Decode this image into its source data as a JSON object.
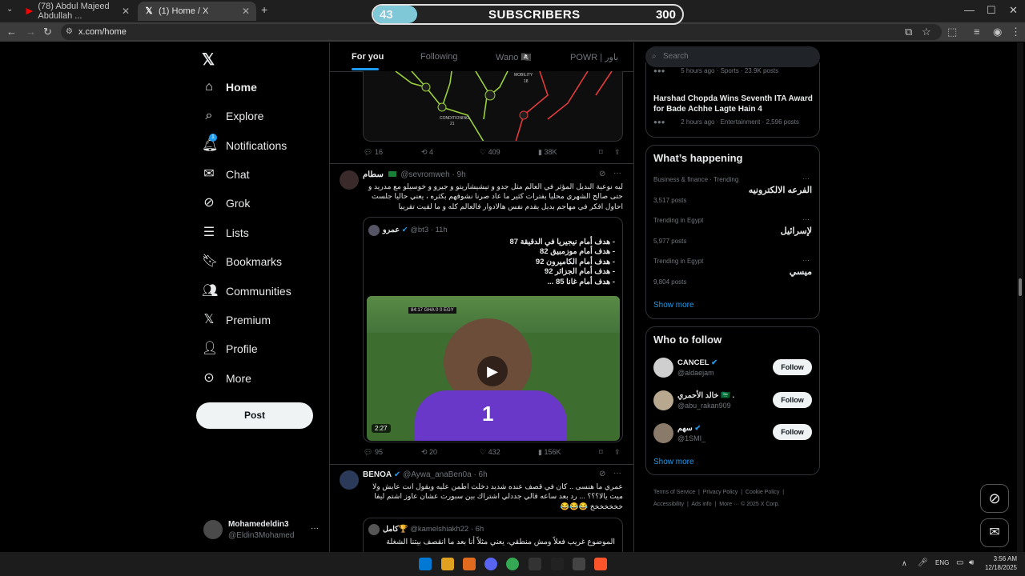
{
  "browser": {
    "tabs": [
      {
        "title": "(78) Abdul Majeed Abdullah ...",
        "icon": "youtube-icon"
      },
      {
        "title": "(1) Home / X",
        "icon": "x-logo-icon"
      }
    ],
    "url": "x.com/home"
  },
  "overlay": {
    "current": "43",
    "label": "SUBSCRIBERS",
    "goal": "300",
    "progress": 0.143
  },
  "nav": {
    "items": [
      "Home",
      "Explore",
      "Notifications",
      "Chat",
      "Grok",
      "Lists",
      "Bookmarks",
      "Communities",
      "Premium",
      "Profile",
      "More"
    ],
    "notification_badge": "1",
    "post_label": "Post"
  },
  "account": {
    "name": "Mohamedeldin3",
    "handle": "@Eldin3Mohamed"
  },
  "feed": {
    "tabs": [
      "For you",
      "Following",
      "Wano 🏴‍☠️",
      "POWR | باور"
    ],
    "first_tweet_actions": {
      "replies": "16",
      "reposts": "4",
      "likes": "409",
      "views": "38K"
    },
    "diagram_labels": {
      "mobility": "MOBILITY",
      "conditioning": "CONDITIONING",
      "num1": "18",
      "num2": "21"
    },
    "tweet2": {
      "name": "سطام",
      "handle": "@sevromweh",
      "time": "· 9h",
      "text": "ليه نوعية البديل المؤثر في العالم مثل جدو و تيشيشاريتو و جيرو و خوسيلو مع مدريد و حتى صالح الشهري محليا بفترات كثير ما عاد صرنا نشوفهم بكثره ، يعني حاليا جلست احاول افكر في مهاجم بديل يقدم نفس هالادوار فالعالم كله و ما لقيت تقريبا",
      "quote": {
        "name": "عمرو",
        "handle": "@bt3",
        "time": "· 11h",
        "lines": [
          "- هدف أمام نيجيريا في الدقيقة 87",
          "- هدف أمام موزمبيق 82",
          "- هدف أمام الكاميرون 92",
          "- هدف أمام الجزائر 92",
          "- هدف أمام غانا 85 ..."
        ],
        "video_duration": "2:27",
        "scoreboard": "84:17 GHA 0 0 EGY",
        "jersey": "1"
      },
      "actions": {
        "replies": "95",
        "reposts": "20",
        "likes": "432",
        "views": "156K"
      }
    },
    "tweet3": {
      "name": "BENOA",
      "handle": "@Aywa_anaBen0a",
      "time": "· 6h",
      "text": "عمري ما هنسى .. كان في قصف عنده شديد دخلت اطمن عليه ويقول انت عايش ولا ميت يالا؟؟؟ ... رد بعد ساعه قالي جددلي اشتراك بين سبورت عشان عاوز اشتم ليفا خخخخخخخ 😂😂😂",
      "quote": {
        "name": "كامل🏆",
        "handle": "@kamelshiakh22",
        "time": "· 6h",
        "text": "الموضوع غريب فعلاً ومش منطقي، يعني مثلاً أنا بعد ما انقصف بيتنا الشغلة"
      }
    }
  },
  "sidebar": {
    "search_placeholder": "Search",
    "top_trend": {
      "meta_partial": "5 hours ago · Sports · 23.9K posts",
      "title": "Harshad Chopda Wins Seventh ITA Award for Bade Achhe Lagte Hain 4",
      "meta": "2 hours ago · Entertainment · 2,596 posts"
    },
    "happening_title": "What’s happening",
    "trends": [
      {
        "context": "Business & finance · Trending",
        "name": "الفرعه الالكترونيه",
        "posts": "3,517 posts"
      },
      {
        "context": "Trending in Egypt",
        "name": "لإسرائيل",
        "posts": "5,977 posts"
      },
      {
        "context": "Trending in Egypt",
        "name": "ميسي",
        "posts": "9,804 posts"
      }
    ],
    "show_more": "Show more",
    "who_to_follow_title": "Who to follow",
    "follow": [
      {
        "name": "CANCEL",
        "handle": "@aldaejam"
      },
      {
        "name": "خالد الأحمري 🇸🇦 .",
        "handle": "@abu_rakan909"
      },
      {
        "name": "سهم",
        "handle": "@1SMI_"
      }
    ],
    "follow_label": "Follow",
    "footer": [
      "Terms of Service",
      "Privacy Policy",
      "Cookie Policy",
      "Accessibility",
      "Ads info",
      "More ···",
      "© 2025 X Corp."
    ]
  },
  "taskbar": {
    "lang": "ENG",
    "time": "3:56 AM",
    "date": "12/18/2025"
  },
  "colors": {
    "accent": "#1d9bf0",
    "bg": "#000000",
    "border": "#2f3336",
    "muted": "#71767b",
    "progress": "#7ec8d8"
  }
}
